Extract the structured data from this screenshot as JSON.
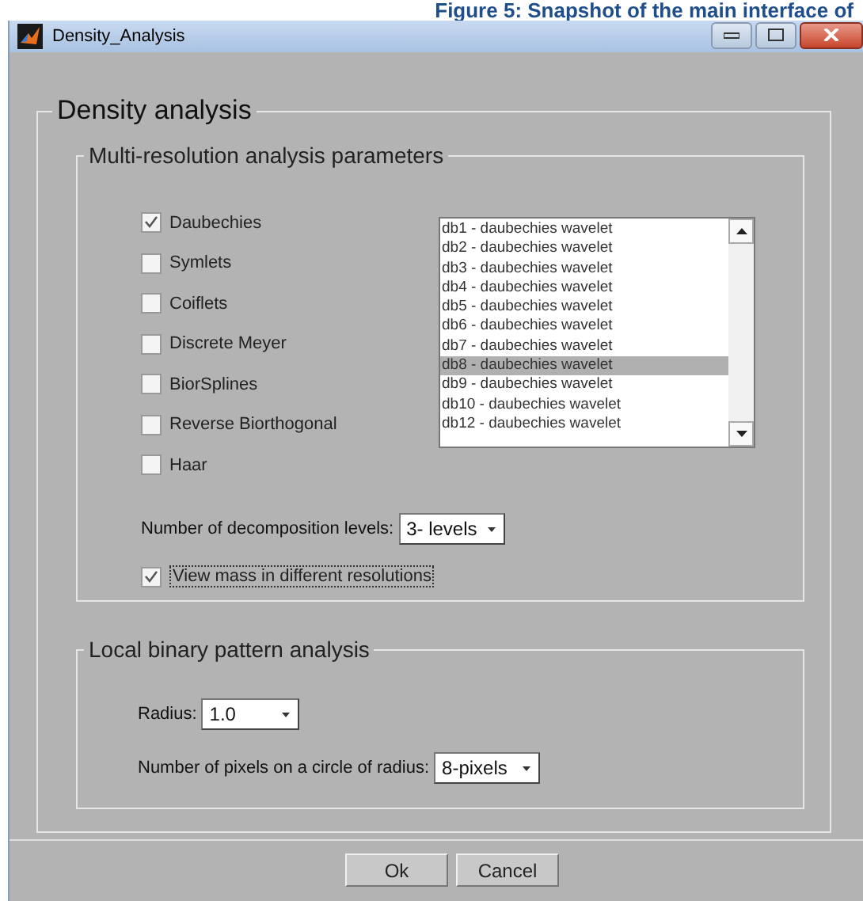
{
  "caption": "Figure 5: Snapshot of the main interface of",
  "window": {
    "title": "Density_Analysis"
  },
  "panel": {
    "title": "Density analysis"
  },
  "mra": {
    "title": "Multi-resolution analysis parameters",
    "wavelets": [
      {
        "label": "Daubechies",
        "checked": true
      },
      {
        "label": "Symlets",
        "checked": false
      },
      {
        "label": "Coiflets",
        "checked": false
      },
      {
        "label": "Discrete Meyer",
        "checked": false
      },
      {
        "label": "BiorSplines",
        "checked": false
      },
      {
        "label": "Reverse Biorthogonal",
        "checked": false
      },
      {
        "label": "Haar",
        "checked": false
      }
    ],
    "list": [
      {
        "label": "db1 - daubechies wavelet",
        "selected": false
      },
      {
        "label": "db2 - daubechies wavelet",
        "selected": false
      },
      {
        "label": "db3 - daubechies wavelet",
        "selected": false
      },
      {
        "label": "db4 - daubechies wavelet",
        "selected": false
      },
      {
        "label": "db5 - daubechies wavelet",
        "selected": false
      },
      {
        "label": "db6 - daubechies wavelet",
        "selected": false
      },
      {
        "label": "db7 - daubechies wavelet",
        "selected": false
      },
      {
        "label": "db8 - daubechies wavelet",
        "selected": true
      },
      {
        "label": "db9 - daubechies wavelet",
        "selected": false
      },
      {
        "label": "db10 - daubechies wavelet",
        "selected": false
      },
      {
        "label": "db12 - daubechies wavelet",
        "selected": false
      }
    ],
    "levels_label": "Number of decomposition levels:",
    "levels_value": "3- levels",
    "view_mass": {
      "label": "View mass in different resolutions",
      "checked": true
    }
  },
  "lbp": {
    "title": "Local binary pattern analysis",
    "radius_label": "Radius:",
    "radius_value": "1.0",
    "pixels_label": "Number of pixels on a circle of radius:",
    "pixels_value": "8-pixels"
  },
  "buttons": [
    "Ok",
    "Cancel"
  ]
}
